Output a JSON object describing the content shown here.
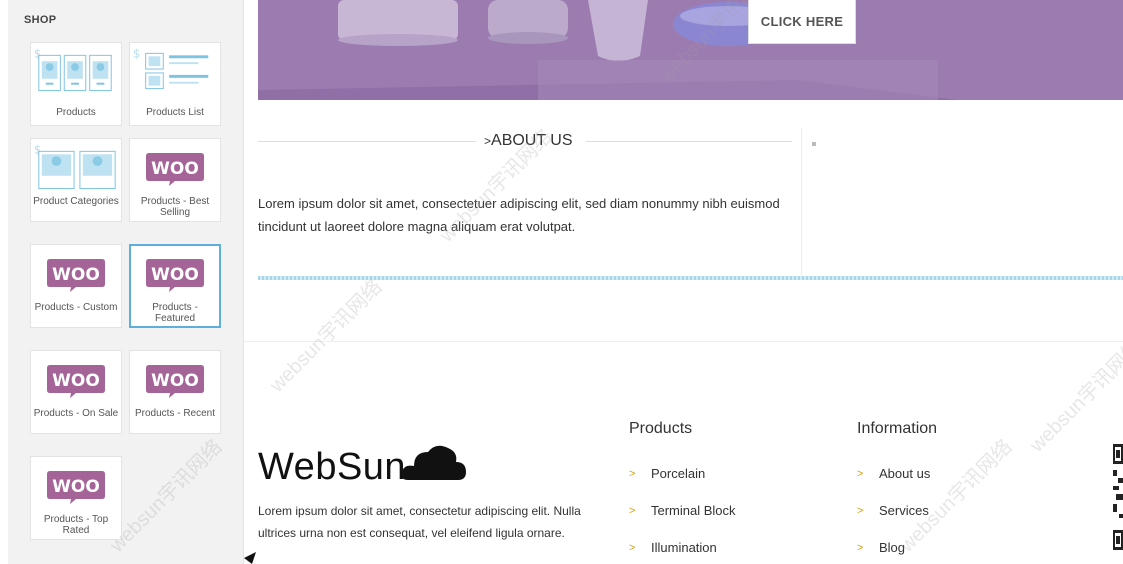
{
  "panel": {
    "title": "SHOP",
    "tiles": [
      {
        "label": "Products"
      },
      {
        "label": "Products List"
      },
      {
        "label": "Product Categories"
      },
      {
        "label": "Products - Best Selling"
      },
      {
        "label": "Products - Custom"
      },
      {
        "label": "Products - Featured"
      },
      {
        "label": "Products - On Sale"
      },
      {
        "label": "Products - Recent"
      },
      {
        "label": "Products - Top Rated"
      }
    ],
    "woo_text": "WOO"
  },
  "hero": {
    "cta_label": "CLICK HERE"
  },
  "about": {
    "title": "ABOUT US",
    "chevron": ">",
    "text": "Lorem ipsum dolor sit amet, consectetuer adipiscing elit, sed diam nonummy nibh euismod tincidunt ut laoreet dolore magna aliquam erat volutpat."
  },
  "footer": {
    "brand": "WebSun",
    "text": "Lorem ipsum dolor sit amet, consectetur adipiscing elit. Nulla ultrices urna non est consequat, vel eleifend ligula ornare.",
    "columns": [
      {
        "title": "Products",
        "links": [
          "Porcelain",
          "Terminal Block",
          "Illumination"
        ]
      },
      {
        "title": "Information",
        "links": [
          "About us",
          "Services",
          "Blog"
        ]
      }
    ],
    "chevron": ">"
  },
  "watermark": "websun宇讯网络",
  "colors": {
    "hero": "#9b7bb0",
    "woo": "#a46497",
    "accent": "#5fb0d8"
  }
}
